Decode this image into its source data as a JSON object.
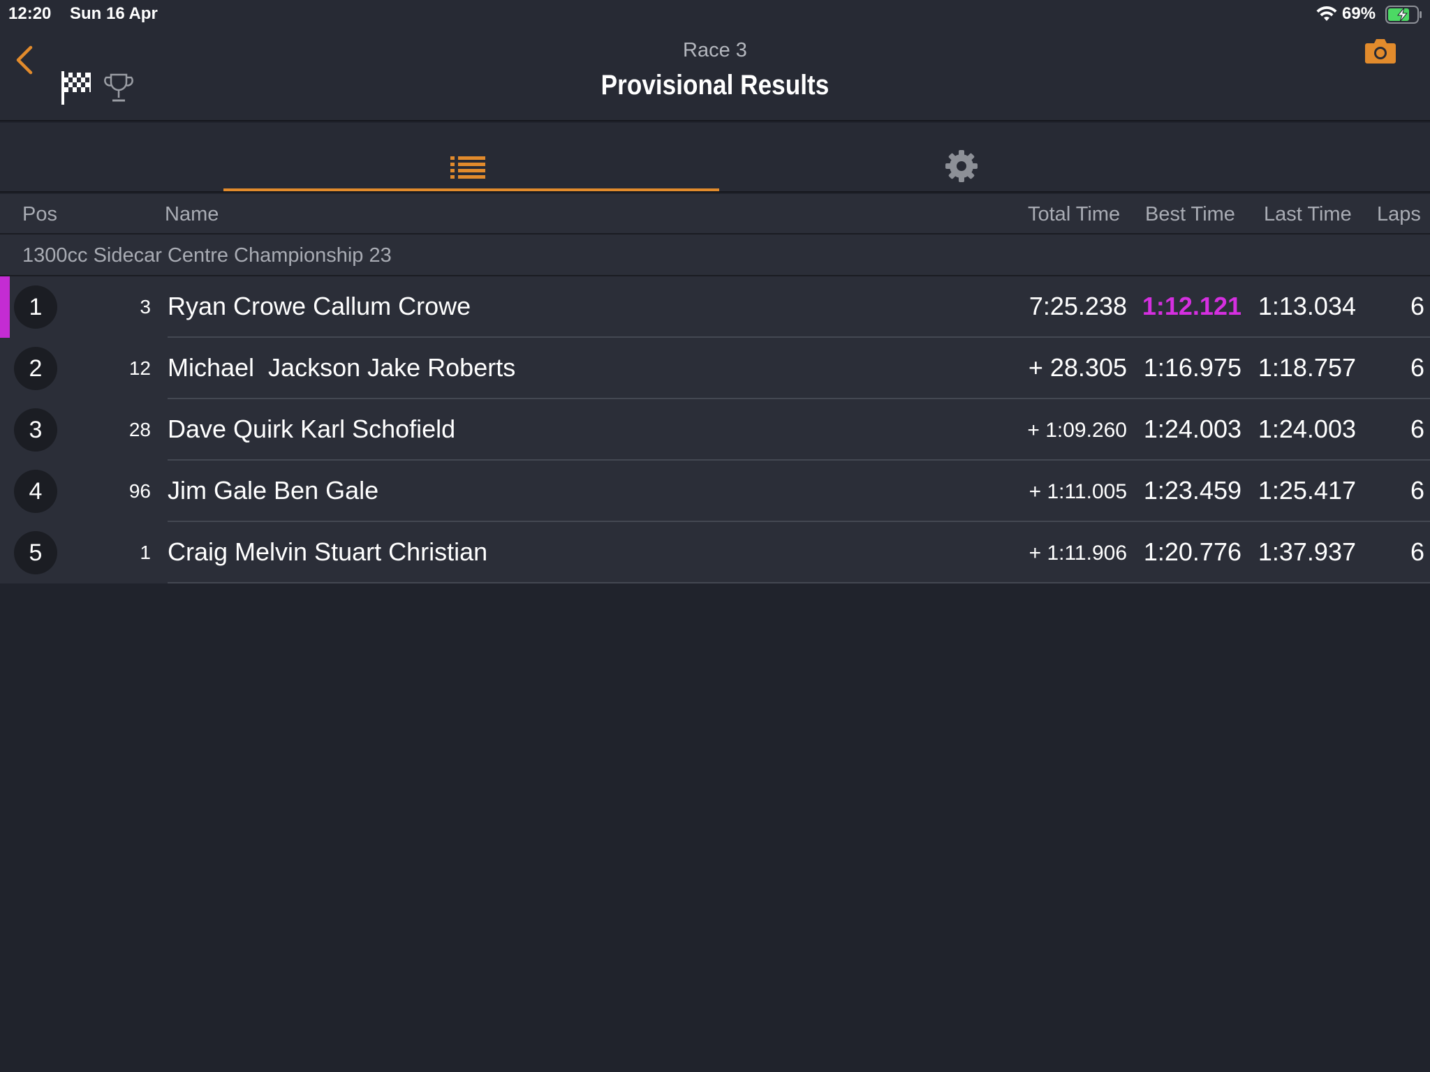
{
  "status_bar": {
    "time": "12:20",
    "date": "Sun 16 Apr",
    "battery_percent": "69%",
    "icons": [
      "wifi-icon",
      "battery-charging-icon"
    ]
  },
  "header": {
    "subtitle": "Race 3",
    "title": "Provisional Results",
    "icons": [
      "back-chevron-icon",
      "checkered-flag-icon",
      "trophy-icon",
      "camera-icon"
    ],
    "accent_color": "#e28b2c"
  },
  "tabs": [
    {
      "icon": "list-icon",
      "active": true
    },
    {
      "icon": "gear-icon",
      "active": false
    }
  ],
  "columns": {
    "pos": "Pos",
    "name": "Name",
    "total_time": "Total Time",
    "best_time": "Best Time",
    "last_time": "Last Time",
    "laps": "Laps"
  },
  "group": {
    "title": "1300cc Sidecar Centre Championship 23"
  },
  "rows": [
    {
      "pos": "1",
      "num": "3",
      "name": "Ryan Crowe Callum Crowe",
      "total": "7:25.238",
      "best": "1:12.121",
      "last": "1:13.034",
      "laps": "6"
    },
    {
      "pos": "2",
      "num": "12",
      "name": "Michael  Jackson Jake Roberts",
      "total": "+ 28.305",
      "best": "1:16.975",
      "last": "1:18.757",
      "laps": "6"
    },
    {
      "pos": "3",
      "num": "28",
      "name": "Dave Quirk Karl Schofield",
      "total": "+ 1:09.260",
      "best": "1:24.003",
      "last": "1:24.003",
      "laps": "6"
    },
    {
      "pos": "4",
      "num": "96",
      "name": "Jim Gale Ben Gale",
      "total": "+ 1:11.005",
      "best": "1:23.459",
      "last": "1:25.417",
      "laps": "6"
    },
    {
      "pos": "5",
      "num": "1",
      "name": "Craig Melvin Stuart Christian",
      "total": "+ 1:11.906",
      "best": "1:20.776",
      "last": "1:37.937",
      "laps": "6"
    }
  ],
  "colors": {
    "fastest_lap": "#d52fe0",
    "leader_marker": "#c42cd3",
    "background": "#20232c",
    "row_background": "#2b2e38"
  }
}
